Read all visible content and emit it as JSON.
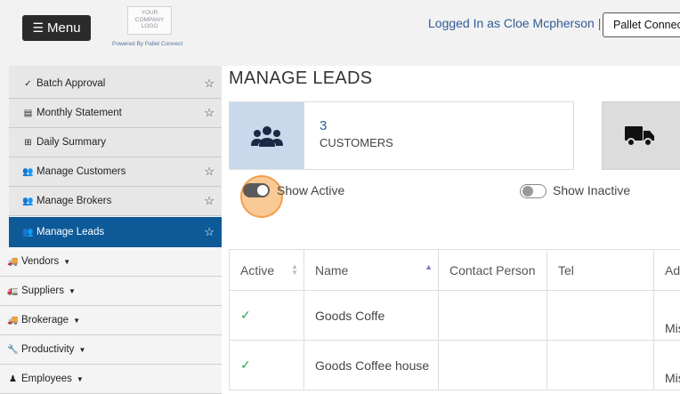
{
  "header": {
    "menu_label": "Menu",
    "logo_lines": [
      "YOUR",
      "COMPANY",
      "LOGO"
    ],
    "powered_by": "Powered By Pallet Connect",
    "logged_in_text": "Logged In as Cloe Mcpherson",
    "separator": "|",
    "pallet_connect_button": "Pallet Connect"
  },
  "sidebar": {
    "items": [
      {
        "label": "Batch Approval",
        "icon": "check-icon",
        "glyph": "✓",
        "starred": true
      },
      {
        "label": "Monthly Statement",
        "icon": "statement-icon",
        "glyph": "▤",
        "starred": true
      },
      {
        "label": "Daily Summary",
        "icon": "table-icon",
        "glyph": "⊞",
        "starred": false
      },
      {
        "label": "Manage Customers",
        "icon": "users-icon",
        "glyph": "👥",
        "starred": true
      },
      {
        "label": "Manage Brokers",
        "icon": "users-icon",
        "glyph": "👥",
        "starred": true
      },
      {
        "label": "Manage Leads",
        "icon": "users-icon",
        "glyph": "👥",
        "starred": true,
        "active": true
      }
    ],
    "sections": [
      {
        "label": "Vendors",
        "icon": "truck-icon",
        "glyph": "🚚"
      },
      {
        "label": "Suppliers",
        "icon": "supplier-icon",
        "glyph": "🚛"
      },
      {
        "label": "Brokerage",
        "icon": "truck-icon",
        "glyph": "🚚"
      },
      {
        "label": "Productivity",
        "icon": "wrench-icon",
        "glyph": "🔧"
      },
      {
        "label": "Employees",
        "icon": "person-icon",
        "glyph": "♟"
      }
    ]
  },
  "page": {
    "title": "MANAGE LEADS"
  },
  "cards": {
    "customers": {
      "count": "3",
      "label": "CUSTOMERS"
    }
  },
  "filters": {
    "show_active": "Show Active",
    "show_inactive": "Show Inactive"
  },
  "table": {
    "columns": [
      "Active",
      "Name",
      "Contact Person",
      "Tel",
      "Ad"
    ],
    "rows": [
      {
        "active": "✓",
        "name": "Goods Coffe",
        "contact": "",
        "tel": "",
        "address": "Mis"
      },
      {
        "active": "✓",
        "name": "Goods Coffee house",
        "contact": "",
        "tel": "",
        "address": "Mis"
      }
    ]
  },
  "colors": {
    "active_nav": "#0e5a99",
    "link_blue": "#2f5c98",
    "check_green": "#2ea84a",
    "highlight_orange": "#f49d3f"
  }
}
